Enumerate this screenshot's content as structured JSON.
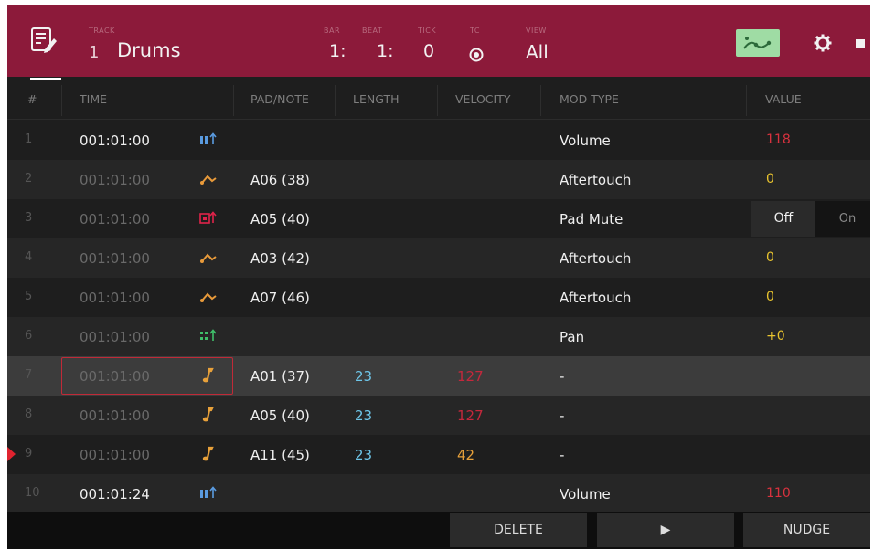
{
  "header": {
    "track_label": "TRACK",
    "track_number": "1",
    "track_name": "Drums",
    "bar_label": "BAR",
    "bar_value": "1:",
    "beat_label": "BEAT",
    "beat_value": "1:",
    "tick_label": "TICK",
    "tick_value": "0",
    "tc_label": "TC",
    "view_label": "VIEW",
    "view_value": "All"
  },
  "columns": {
    "num": "#",
    "time": "TIME",
    "pad_note": "PAD/NOTE",
    "length": "LENGTH",
    "velocity": "VELOCITY",
    "mod_type": "MOD TYPE",
    "value": "VALUE"
  },
  "rows": [
    {
      "num": "1",
      "time": "001:01:00",
      "icon": "volume-event-icon",
      "pad": "",
      "length": "",
      "velocity": "",
      "mod": "Volume",
      "value": "118"
    },
    {
      "num": "2",
      "time": "001:01:00",
      "icon": "aftertouch-event-icon",
      "pad": "A06 (38)",
      "length": "",
      "velocity": "",
      "mod": "Aftertouch",
      "value": "0"
    },
    {
      "num": "3",
      "time": "001:01:00",
      "icon": "pad-mute-event-icon",
      "pad": "A05 (40)",
      "length": "",
      "velocity": "",
      "mod": "Pad Mute",
      "value": ""
    },
    {
      "num": "4",
      "time": "001:01:00",
      "icon": "aftertouch-event-icon",
      "pad": "A03 (42)",
      "length": "",
      "velocity": "",
      "mod": "Aftertouch",
      "value": "0"
    },
    {
      "num": "5",
      "time": "001:01:00",
      "icon": "aftertouch-event-icon",
      "pad": "A07 (46)",
      "length": "",
      "velocity": "",
      "mod": "Aftertouch",
      "value": "0"
    },
    {
      "num": "6",
      "time": "001:01:00",
      "icon": "pan-event-icon",
      "pad": "",
      "length": "",
      "velocity": "",
      "mod": "Pan",
      "value": "+0"
    },
    {
      "num": "7",
      "time": "001:01:00",
      "icon": "note-event-icon",
      "pad": "A01 (37)",
      "length": "23",
      "velocity": "127",
      "mod": "-",
      "value": ""
    },
    {
      "num": "8",
      "time": "001:01:00",
      "icon": "note-event-icon",
      "pad": "A05 (40)",
      "length": "23",
      "velocity": "127",
      "mod": "-",
      "value": ""
    },
    {
      "num": "9",
      "time": "001:01:00",
      "icon": "note-event-icon",
      "pad": "A11 (45)",
      "length": "23",
      "velocity": "42",
      "mod": "-",
      "value": ""
    },
    {
      "num": "10",
      "time": "001:01:24",
      "icon": "volume-event-icon",
      "pad": "",
      "length": "",
      "velocity": "",
      "mod": "Volume",
      "value": "110"
    }
  ],
  "toggle": {
    "off": "Off",
    "on": "On",
    "selected": "Off"
  },
  "buttons": {
    "delete": "DELETE",
    "play": "▶",
    "nudge": "NUDGE"
  },
  "colors": {
    "header_bg": "#8c1a3a",
    "value_red": "#d8323e",
    "value_yellow": "#e9c42e",
    "velocity_orange": "#e8a13a",
    "length_blue": "#6ec6e9",
    "control_green": "#9fdca4"
  }
}
